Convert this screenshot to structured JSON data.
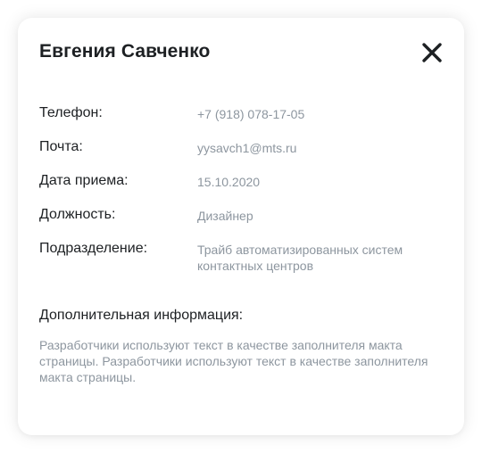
{
  "dialog": {
    "title": "Евгения Савченко",
    "close_icon": "close-icon",
    "fields": [
      {
        "label": "Телефон:",
        "value": "+7 (918) 078-17-05"
      },
      {
        "label": "Почта:",
        "value": "yysavch1@mts.ru"
      },
      {
        "label": "Дата приема:",
        "value": "15.10.2020"
      },
      {
        "label": "Должность:",
        "value": "Дизайнер"
      },
      {
        "label": "Подразделение:",
        "value": "Трайб автоматизированных систем контактных центров"
      }
    ],
    "extra": {
      "heading": "Дополнительная информация:",
      "text": "Разработчики используют текст в качестве заполнителя макта страницы. Разработчики используют текст в качестве заполнителя макта страницы."
    }
  },
  "colors": {
    "title": "#1d2023",
    "label": "#1d2023",
    "value": "#8d969f",
    "close_icon": "#1d2023"
  }
}
